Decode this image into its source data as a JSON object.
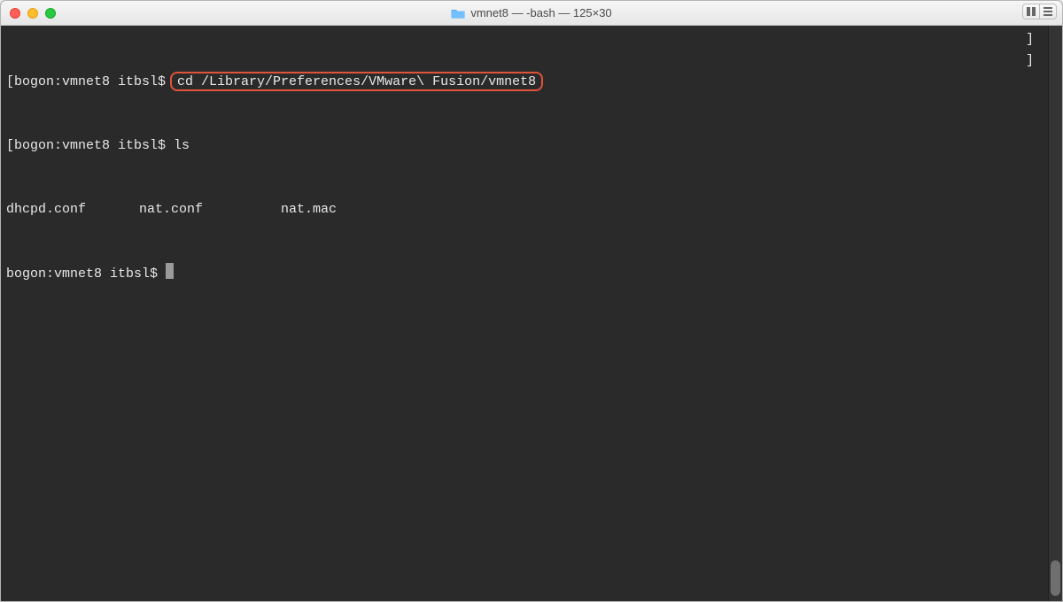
{
  "window": {
    "title": "vmnet8 — -bash — 125×30"
  },
  "terminal": {
    "lines": {
      "l1_prefix": "[bogon:vmnet8 itbsl$ ",
      "l1_cmd": "cd /Library/Preferences/VMware\\ Fusion/vmnet8",
      "l1_suffix": "]",
      "l2_prefix": "[bogon:vmnet8 itbsl$ ",
      "l2_cmd": "ls",
      "l2_suffix": "]",
      "files": {
        "f1": "dhcpd.conf",
        "f2": "nat.conf",
        "f3": "nat.mac"
      },
      "l4_prefix": "bogon:vmnet8 itbsl$ "
    }
  }
}
